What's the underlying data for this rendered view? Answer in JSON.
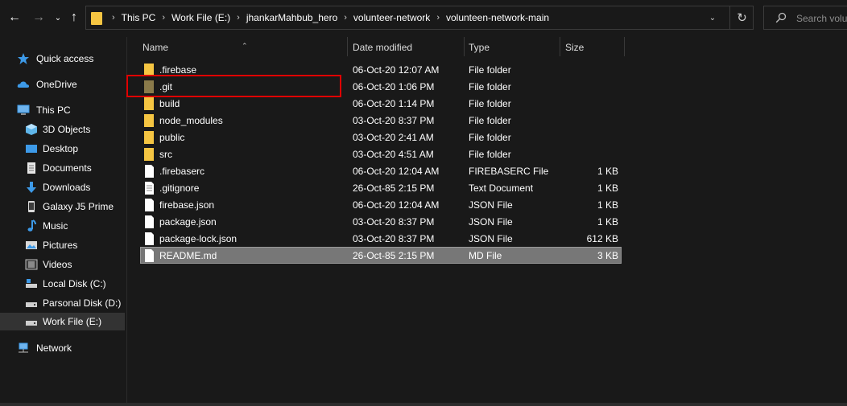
{
  "address_bar": {
    "breadcrumbs": [
      "This PC",
      "Work File (E:)",
      "jhankarMahbub_hero",
      "volunteer-network",
      "volunteen-network-main"
    ],
    "search_placeholder": "Search volu"
  },
  "sidebar": {
    "items": [
      {
        "label": "Quick access",
        "icon": "star-icon"
      },
      {
        "label": "OneDrive",
        "icon": "cloud-icon"
      },
      {
        "label": "This PC",
        "icon": "computer-icon"
      },
      {
        "label": "3D Objects",
        "icon": "cube-icon"
      },
      {
        "label": "Desktop",
        "icon": "desktop-icon"
      },
      {
        "label": "Documents",
        "icon": "document-icon"
      },
      {
        "label": "Downloads",
        "icon": "download-icon"
      },
      {
        "label": "Galaxy J5 Prime",
        "icon": "phone-icon"
      },
      {
        "label": "Music",
        "icon": "music-icon"
      },
      {
        "label": "Pictures",
        "icon": "picture-icon"
      },
      {
        "label": "Videos",
        "icon": "video-icon"
      },
      {
        "label": "Local Disk (C:)",
        "icon": "drive-icon"
      },
      {
        "label": "Parsonal Disk (D:)",
        "icon": "drive-icon"
      },
      {
        "label": "Work File (E:)",
        "icon": "drive-icon",
        "selected": true
      },
      {
        "label": "Network",
        "icon": "network-icon"
      }
    ]
  },
  "list": {
    "columns": {
      "name": "Name",
      "date": "Date modified",
      "type": "Type",
      "size": "Size"
    },
    "files": [
      {
        "name": ".firebase",
        "date": "06-Oct-20 12:07 AM",
        "type": "File folder",
        "size": "",
        "kind": "folder"
      },
      {
        "name": ".git",
        "date": "06-Oct-20 1:06 PM",
        "type": "File folder",
        "size": "",
        "kind": "folder-hidden"
      },
      {
        "name": "build",
        "date": "06-Oct-20 1:14 PM",
        "type": "File folder",
        "size": "",
        "kind": "folder"
      },
      {
        "name": "node_modules",
        "date": "03-Oct-20 8:37 PM",
        "type": "File folder",
        "size": "",
        "kind": "folder"
      },
      {
        "name": "public",
        "date": "03-Oct-20 2:41 AM",
        "type": "File folder",
        "size": "",
        "kind": "folder"
      },
      {
        "name": "src",
        "date": "03-Oct-20 4:51 AM",
        "type": "File folder",
        "size": "",
        "kind": "folder"
      },
      {
        "name": ".firebaserc",
        "date": "06-Oct-20 12:04 AM",
        "type": "FIREBASERC File",
        "size": "1 KB",
        "kind": "file"
      },
      {
        "name": ".gitignore",
        "date": "26-Oct-85 2:15 PM",
        "type": "Text Document",
        "size": "1 KB",
        "kind": "text"
      },
      {
        "name": "firebase.json",
        "date": "06-Oct-20 12:04 AM",
        "type": "JSON File",
        "size": "1 KB",
        "kind": "file"
      },
      {
        "name": "package.json",
        "date": "03-Oct-20 8:37 PM",
        "type": "JSON File",
        "size": "1 KB",
        "kind": "file"
      },
      {
        "name": "package-lock.json",
        "date": "03-Oct-20 8:37 PM",
        "type": "JSON File",
        "size": "612 KB",
        "kind": "file"
      },
      {
        "name": "README.md",
        "date": "26-Oct-85 2:15 PM",
        "type": "MD File",
        "size": "3 KB",
        "kind": "file",
        "selected": true
      }
    ]
  },
  "colors": {
    "background": "#191919",
    "folder": "#f5c542",
    "hidden_folder": "#8a7a4a",
    "selection": "#777777",
    "highlight_box": "#e00000"
  }
}
